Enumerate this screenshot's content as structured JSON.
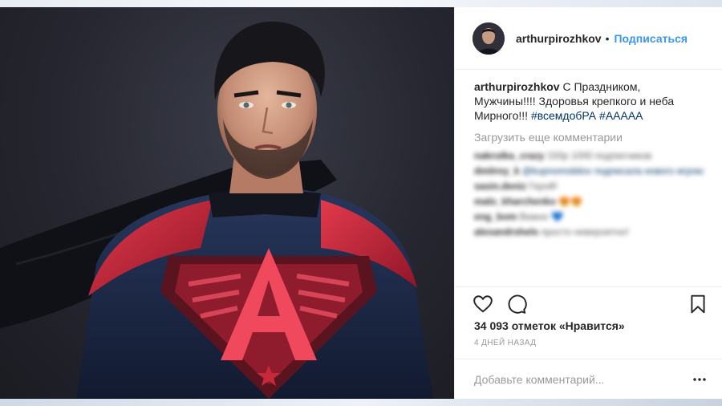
{
  "post": {
    "username": "arthurpirozhkov",
    "separator": "•",
    "follow_label": "Подписаться",
    "caption": {
      "username": "arthurpirozhkov",
      "text": " С Праздником, Мужчины!!!! Здоровья крепкого и неба Мирного!!! ",
      "hashtags": [
        "#всемдобРА",
        "#АAAAA"
      ]
    },
    "load_more_label": "Загрузить еще комментарии",
    "blurred_comments": [
      {
        "user": "nakrutka_crazy",
        "text": " 150р 1000 подписчиков"
      },
      {
        "user": "dmitrey_k",
        "text": " @kupnomobilov подписала нового игрока! Артур Шофер похвалили в авто"
      },
      {
        "user": "sasin.deniz",
        "text": " Герой!"
      },
      {
        "user": "malo_kharchenko",
        "text": " 😍😍"
      },
      {
        "user": "eng_bom",
        "text": " Важно 💙"
      },
      {
        "user": "alexandrshels",
        "text": " просто невероятно!"
      }
    ],
    "likes_text": "34 093 отметок «Нравится»",
    "time_ago": "4 ДНЕЙ НАЗАД",
    "comment_placeholder": "Добавьте комментарий...",
    "icons": {
      "like": "heart-icon",
      "comment": "comment-bubble-icon",
      "save": "bookmark-icon",
      "more": "more-options-icon"
    },
    "colors": {
      "link_blue": "#3897f0",
      "hashtag": "#003569",
      "muted": "#999999",
      "text": "#262626",
      "suit_red": "#c8283b",
      "suit_navy": "#1c2a4a"
    }
  }
}
